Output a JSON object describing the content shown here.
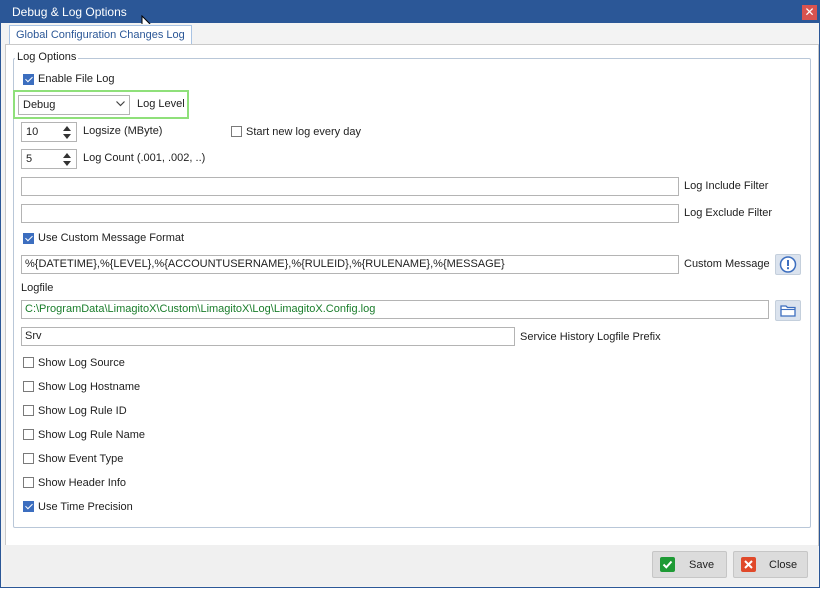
{
  "window": {
    "title": "Debug & Log Options",
    "close_glyph": "✕"
  },
  "tabs": [
    {
      "label": "Global Configuration Changes Log"
    }
  ],
  "group": {
    "title": "Log Options"
  },
  "enable_file_log": {
    "label": "Enable File Log",
    "checked": true
  },
  "log_level": {
    "value": "Debug",
    "label": "Log Level"
  },
  "logsize": {
    "value": "10",
    "label": "Logsize (MByte)"
  },
  "start_new_log": {
    "label": "Start new log every day",
    "checked": false
  },
  "log_count": {
    "value": "5",
    "label": "Log Count (.001, .002, ..)"
  },
  "include_filter": {
    "value": "",
    "label": "Log Include Filter"
  },
  "exclude_filter": {
    "value": "",
    "label": "Log Exclude Filter"
  },
  "use_custom_format": {
    "label": "Use Custom Message Format",
    "checked": true
  },
  "custom_message": {
    "value": "%{DATETIME},%{LEVEL},%{ACCOUNTUSERNAME},%{RULEID},%{RULENAME},%{MESSAGE}",
    "label": "Custom Message"
  },
  "logfile": {
    "label": "Logfile",
    "value": "C:\\ProgramData\\LimagitoX\\Custom\\LimagitoX\\Log\\LimagitoX.Config.log"
  },
  "service_prefix": {
    "value": "Srv",
    "label": "Service History Logfile Prefix"
  },
  "options": [
    {
      "label": "Show Log Source",
      "checked": false
    },
    {
      "label": "Show Log Hostname",
      "checked": false
    },
    {
      "label": "Show Log Rule ID",
      "checked": false
    },
    {
      "label": "Show Log Rule Name",
      "checked": false
    },
    {
      "label": "Show Event Type",
      "checked": false
    },
    {
      "label": "Show Header Info",
      "checked": false
    },
    {
      "label": "Use Time Precision",
      "checked": true
    }
  ],
  "buttons": {
    "save": "Save",
    "close": "Close"
  },
  "colors": {
    "titlebar": "#2b5797",
    "accent": "#3c6ebf",
    "highlight": "#8fe07a",
    "path_text": "#1a7d2b"
  }
}
